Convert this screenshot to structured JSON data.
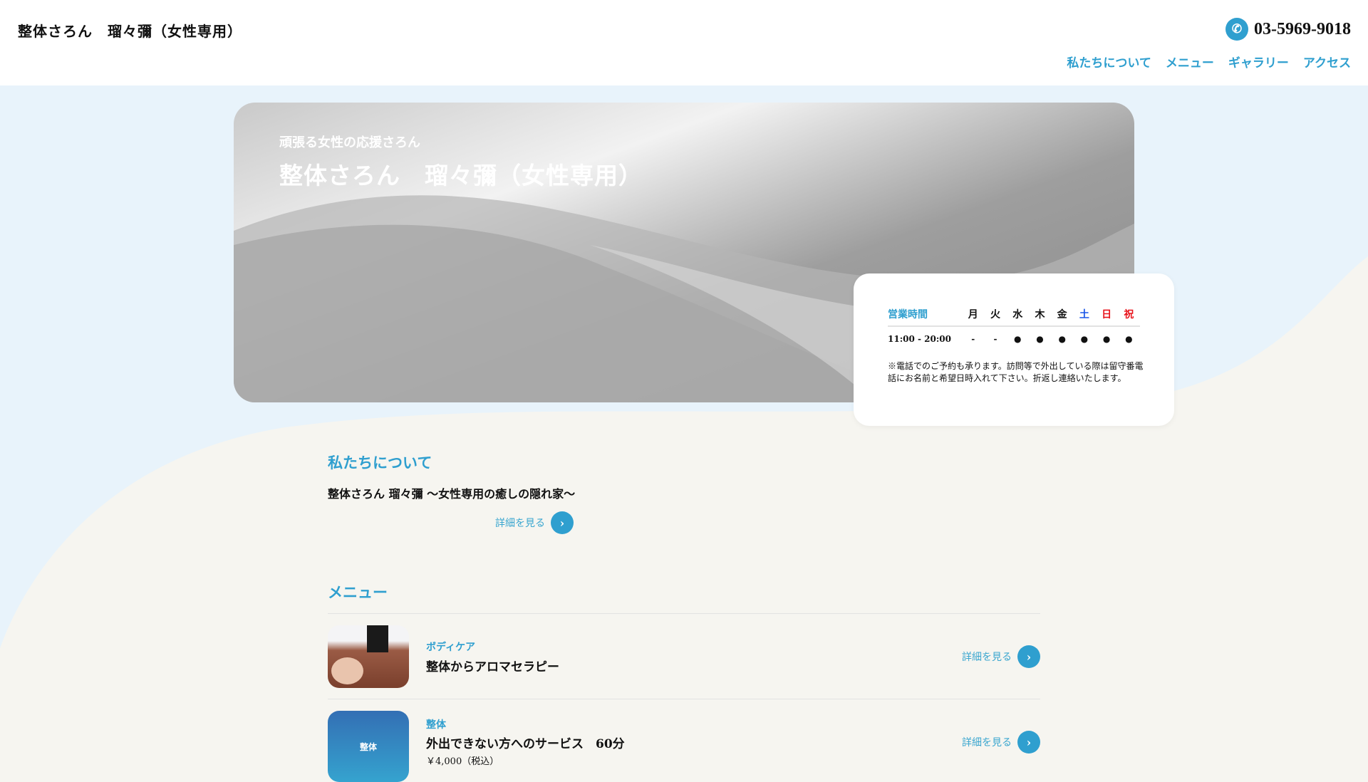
{
  "header": {
    "title": "整体さろん　瑠々彌（女性専用）",
    "phone": "03-5969-9018",
    "nav": [
      "私たちについて",
      "メニュー",
      "ギャラリー",
      "アクセス"
    ]
  },
  "hero": {
    "subtitle": "頑張る女性の応援さろん",
    "title": "整体さろん　瑠々彌（女性専用）"
  },
  "hours": {
    "label": "営業時間",
    "days": [
      "月",
      "火",
      "水",
      "木",
      "金",
      "土",
      "日",
      "祝"
    ],
    "day_colors": [
      "#111",
      "#111",
      "#111",
      "#111",
      "#111",
      "#1a56e8",
      "#e8141c",
      "#e8141c"
    ],
    "time": "11:00 - 20:00",
    "marks": [
      "-",
      "-",
      "●",
      "●",
      "●",
      "●",
      "●",
      "●"
    ],
    "note": "※電話でのご予約も承ります。訪問等で外出している際は留守番電話にお名前と希望日時入れて下さい。折返し連絡いたします。"
  },
  "about": {
    "heading": "私たちについて",
    "text": "整体さろん 瑠々彌 ～女性専用の癒しの隠れ家～",
    "more": "詳細を見る"
  },
  "menu": {
    "heading": "メニュー",
    "items": [
      {
        "category": "ボディケア",
        "name": "整体からアロマセラピー",
        "more": "詳細を見る"
      },
      {
        "category": "整体",
        "name": "外出できない方へのサービス　60分",
        "price": "￥4,000（税込）",
        "thumb_text": "整体",
        "more": "詳細を見る"
      }
    ]
  },
  "colors": {
    "accent": "#2f9fcf",
    "bg_blue": "#e8f3fb",
    "bg_beige": "#f6f5f0"
  }
}
